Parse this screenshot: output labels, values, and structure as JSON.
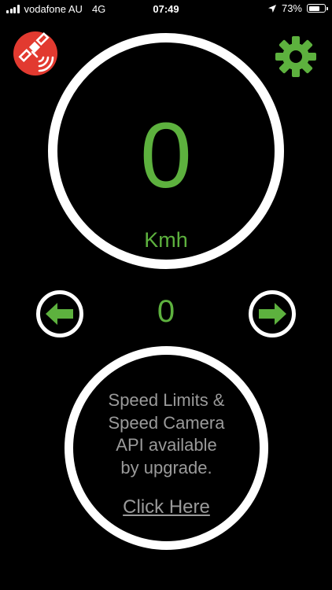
{
  "status_bar": {
    "carrier": "vodafone AU",
    "network": "4G",
    "time": "07:49",
    "battery_percent": "73%",
    "battery_level": 0.73,
    "icons": [
      "signal-icon",
      "location-arrow-icon",
      "battery-icon"
    ]
  },
  "toolbar": {
    "gps_icon": "satellite-signal-icon",
    "settings_icon": "gear-icon"
  },
  "speedometer": {
    "speed": "0",
    "unit": "Kmh"
  },
  "navigator": {
    "value": "0",
    "left_icon": "arrow-left-icon",
    "right_icon": "arrow-right-icon"
  },
  "upgrade": {
    "line1": "Speed Limits &",
    "line2": "Speed Camera",
    "line3": "API available",
    "line4": "by upgrade.",
    "link": "Click Here"
  },
  "colors": {
    "accent": "#5db13e",
    "gps_button": "#e23a30",
    "muted_text": "#9a9a9a",
    "background": "#000000",
    "ring": "#ffffff"
  }
}
